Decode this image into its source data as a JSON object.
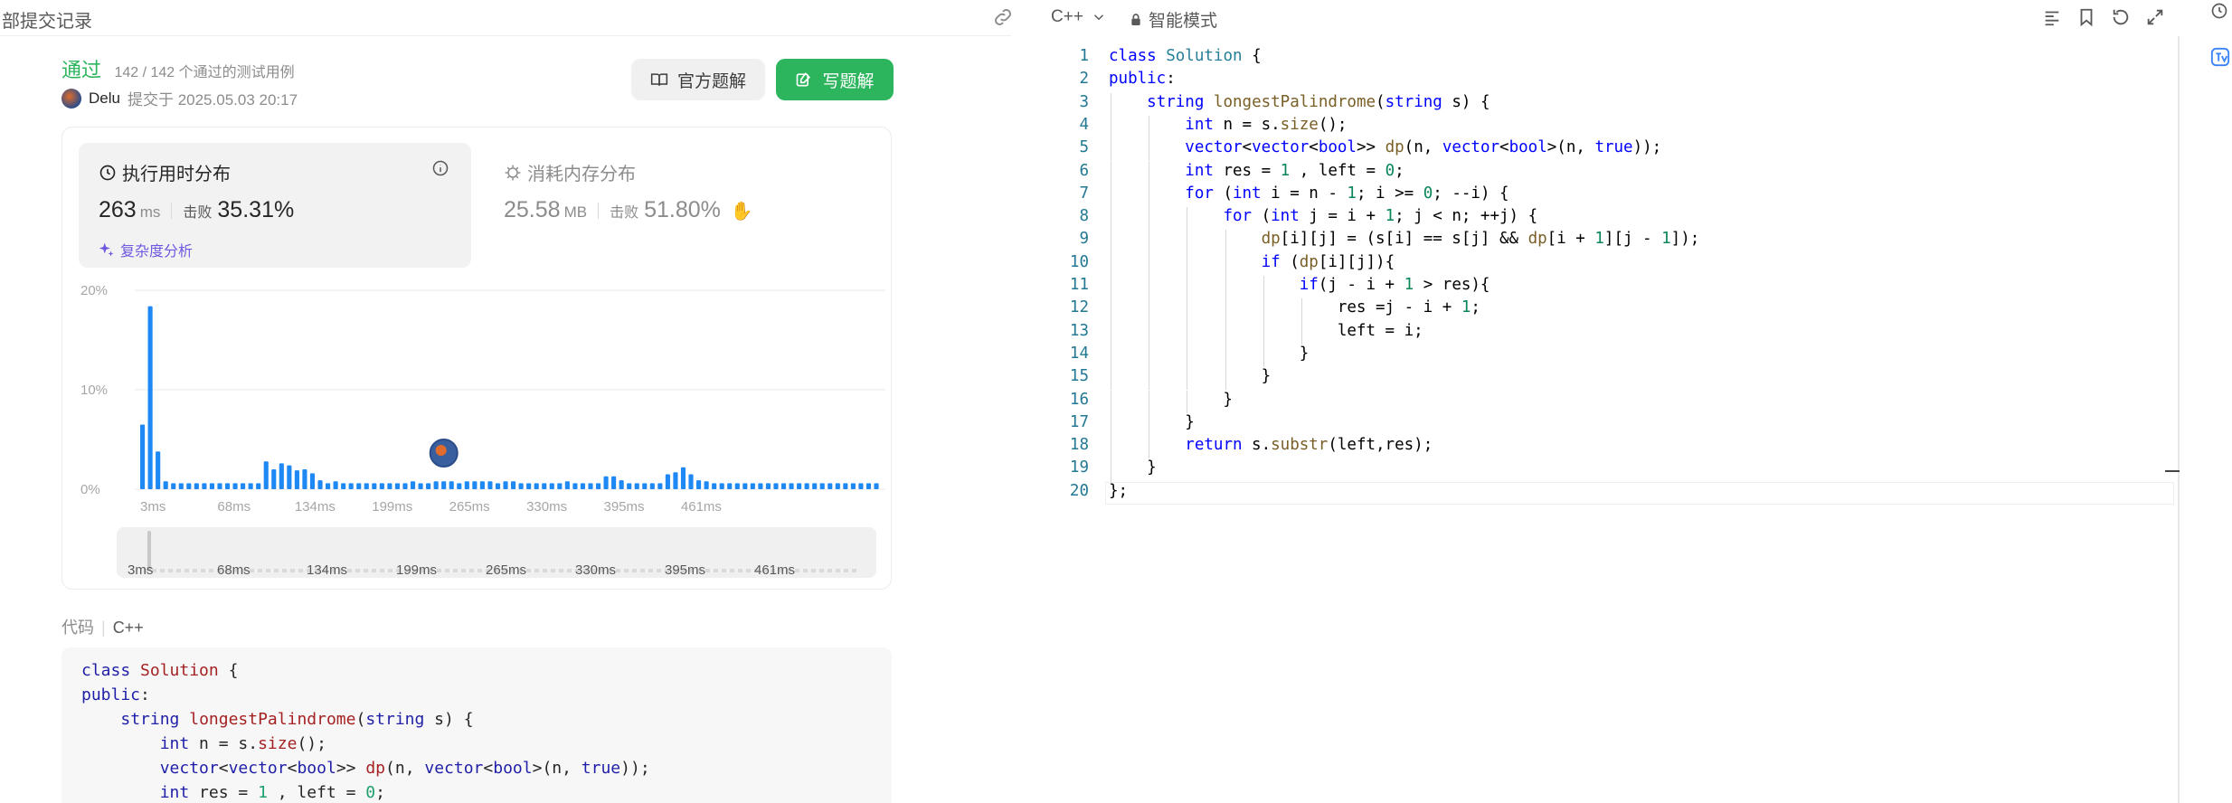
{
  "left": {
    "title": "部提交记录",
    "status": "通过",
    "test_count": "142 / 142 个通过的测试用例",
    "author": "Delu",
    "submitted_at": "提交于 2025.05.03 20:17",
    "official_solution": "官方题解",
    "write_solution": "写题解"
  },
  "runtime": {
    "title": "执行用时分布",
    "value": "263",
    "unit": "ms",
    "beat_label": "击败",
    "beat_pct": "35.31%",
    "complexity": "复杂度分析"
  },
  "memory": {
    "title": "消耗内存分布",
    "value": "25.58",
    "unit": "MB",
    "beat_label": "击败",
    "beat_pct": "51.80%"
  },
  "chart_data": {
    "type": "bar",
    "yticks": [
      "20%",
      "10%",
      "0%"
    ],
    "ylim": [
      0,
      20
    ],
    "xticks": [
      "3ms",
      "68ms",
      "134ms",
      "199ms",
      "265ms",
      "330ms",
      "395ms",
      "461ms"
    ],
    "values": [
      6.5,
      18.4,
      3.8,
      0.8,
      0.6,
      0.6,
      0.6,
      0.6,
      0.6,
      0.6,
      0.6,
      0.6,
      0.6,
      0.6,
      0.6,
      0.6,
      2.8,
      2.0,
      2.6,
      2.4,
      1.9,
      2.0,
      1.6,
      0.9,
      0.6,
      0.8,
      0.6,
      0.6,
      0.6,
      0.6,
      0.6,
      0.6,
      0.6,
      0.6,
      0.6,
      0.8,
      0.6,
      0.6,
      0.8,
      0.8,
      0.8,
      0.6,
      0.8,
      0.8,
      0.8,
      0.8,
      0.6,
      0.8,
      0.8,
      0.6,
      0.6,
      0.6,
      0.6,
      0.6,
      0.6,
      0.8,
      0.6,
      0.6,
      0.6,
      0.6,
      1.3,
      1.3,
      0.9,
      0.6,
      0.6,
      0.6,
      0.6,
      0.6,
      1.5,
      1.7,
      2.2,
      1.5,
      0.9,
      0.8,
      0.6,
      0.6,
      0.6,
      0.6,
      0.6,
      0.6,
      0.6,
      0.6,
      0.6,
      0.6,
      0.6,
      0.6,
      0.6,
      0.6,
      0.6,
      0.6,
      0.6,
      0.6,
      0.6,
      0.6,
      0.6,
      0.6
    ],
    "highlight_bar": 39,
    "bar_color": "#1e88f5",
    "grid": true
  },
  "code_section": {
    "label": "代码",
    "lang": "C++",
    "lines": [
      "class Solution {",
      "public:",
      "    string longestPalindrome(string s) {",
      "        int n = s.size();",
      "        vector<vector<bool>> dp(n, vector<bool>(n, true));",
      "        int res = 1 , left = 0;"
    ]
  },
  "editor": {
    "language": "C++",
    "mode": "智能模式",
    "lines": [
      "class Solution {",
      "public:",
      "    string longestPalindrome(string s) {",
      "        int n = s.size();",
      "        vector<vector<bool>> dp(n, vector<bool>(n, true));",
      "        int res = 1 , left = 0;",
      "        for (int i = n - 1; i >= 0; --i) {",
      "            for (int j = i + 1; j < n; ++j) {",
      "                dp[i][j] = (s[i] == s[j] && dp[i + 1][j - 1]);",
      "                if (dp[i][j]){",
      "                    if(j - i + 1 > res){",
      "                        res =j - i + 1;",
      "                        left = i;",
      "                    }",
      "                }",
      "            }",
      "        }",
      "        return s.substr(left,res);",
      "    }",
      "};"
    ]
  },
  "colors": {
    "accent_green": "#2db55d",
    "bar_blue": "#1e88f5",
    "purple": "#6f57e0"
  }
}
